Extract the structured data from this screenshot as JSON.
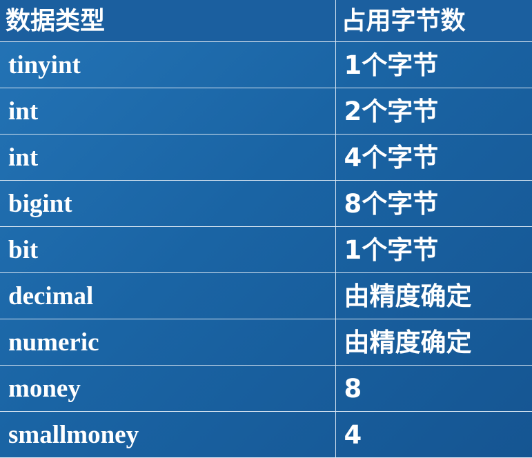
{
  "table": {
    "headers": {
      "type": "数据类型",
      "size": "占用字节数"
    },
    "rows": [
      {
        "type": "tinyint",
        "size": "1个字节"
      },
      {
        "type": "int",
        "size": "2个字节"
      },
      {
        "type": "int",
        "size": "4个字节"
      },
      {
        "type": "bigint",
        "size": "8个字节"
      },
      {
        "type": "bit",
        "size": "1个字节"
      },
      {
        "type": "decimal",
        "size": "由精度确定"
      },
      {
        "type": "numeric",
        "size": "由精度确定"
      },
      {
        "type": "money",
        "size": "8"
      },
      {
        "type": "smallmoney",
        "size": "4"
      }
    ]
  },
  "colors": {
    "background": "#1a64a4",
    "grid": "#d9e6f2",
    "text": "#ffffff"
  }
}
